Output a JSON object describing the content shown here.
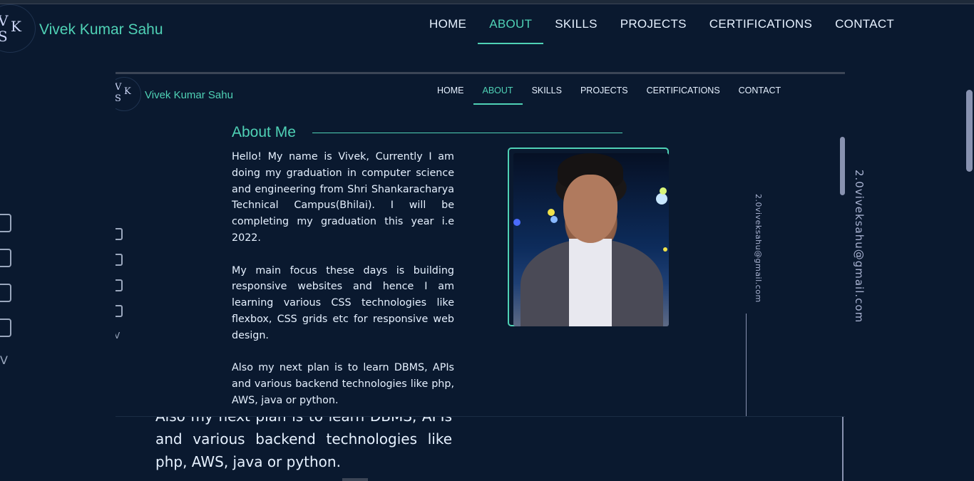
{
  "outer": {
    "logo": {
      "l1": "V",
      "l2": "K",
      "l3": "S"
    },
    "brand": "Vivek Kumar Sahu",
    "nav": [
      "HOME",
      "ABOUT",
      "SKILLS",
      "PROJECTS",
      "CERTIFICATIONS",
      "CONTACT"
    ],
    "nav_active": "ABOUT",
    "side_icons": [
      "github-icon",
      "linkedin-icon",
      "instagram-icon",
      "mail-icon"
    ],
    "side_last": "V",
    "email": "2.0viveksahu@gmail.com",
    "text": "Also my next plan is to learn DBMS, APIs and various backend technologies like php, AWS, java or python."
  },
  "inner": {
    "logo": {
      "l1": "V",
      "l2": "K",
      "l3": "S"
    },
    "brand": "Vivek Kumar Sahu",
    "nav": [
      "HOME",
      "ABOUT",
      "SKILLS",
      "PROJECTS",
      "CERTIFICATIONS",
      "CONTACT"
    ],
    "side_last": "V",
    "about_title": "About Me",
    "paragraphs": [
      "Hello! My name is Vivek, Currently I am doing my graduation in computer science and engineering from Shri Shankaracharya Technical Campus(Bhilai). I will be completing my graduation this year i.e 2022.",
      "My main focus these days is building responsive websites and hence I am learning various CSS technologies like flexbox, CSS grids etc for responsive web design.",
      "Also my next plan is to learn DBMS, APIs and various backend technologies like php, AWS, java or python."
    ],
    "email": "2.0viveksahu@gmail.com"
  },
  "colors": {
    "bg": "#0a192f",
    "accent": "#4fd1b5",
    "text": "#e6f1ff"
  }
}
